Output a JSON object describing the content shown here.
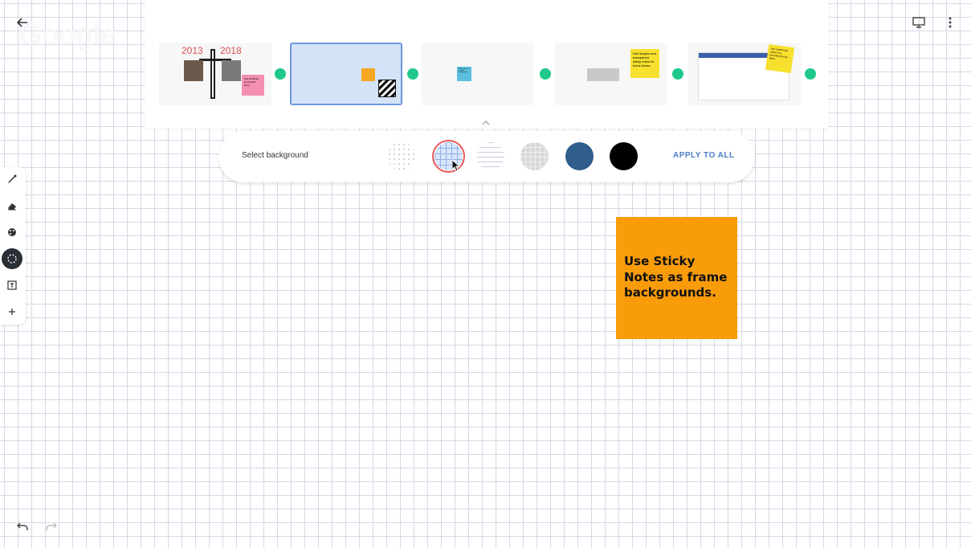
{
  "header": {
    "watermark": "Google",
    "icons": {
      "back": "arrow-back-icon",
      "present": "present-icon",
      "more": "more-vert-icon"
    }
  },
  "frames": {
    "items": [
      {
        "id": "frame-1",
        "years": [
          "2013",
          "2018"
        ],
        "note": "Use timelines for product lines."
      },
      {
        "id": "frame-2",
        "selected": true
      },
      {
        "id": "frame-3",
        "note": "Sticky note as a frame background."
      },
      {
        "id": "frame-4",
        "note": "Use shapes and transparent sticky notes for focus boxes."
      },
      {
        "id": "frame-5",
        "note": "Use content-rich notes on a document for the team."
      }
    ],
    "connector_color": "#1fc98a"
  },
  "background_selector": {
    "label": "Select background",
    "options": [
      "dots",
      "grid",
      "lines",
      "dark-grid",
      "blue",
      "black"
    ],
    "selected": "grid",
    "apply_label": "APPLY TO ALL"
  },
  "sticky_note": {
    "text_lines": [
      "Use Sticky",
      "Notes as frame",
      "backgrounds."
    ],
    "color": "#f99c0a"
  },
  "toolbar": {
    "tools": [
      "pen-icon",
      "eraser-icon",
      "palette-icon",
      "select-icon",
      "text-box-icon",
      "add-icon"
    ],
    "active": "select-icon"
  },
  "history": {
    "undo": "undo-icon",
    "redo": "redo-icon"
  },
  "colors": {
    "accent": "#4a7ec7",
    "selection_ring": "#e85a5a",
    "grid_line": "#d5d9e6"
  }
}
